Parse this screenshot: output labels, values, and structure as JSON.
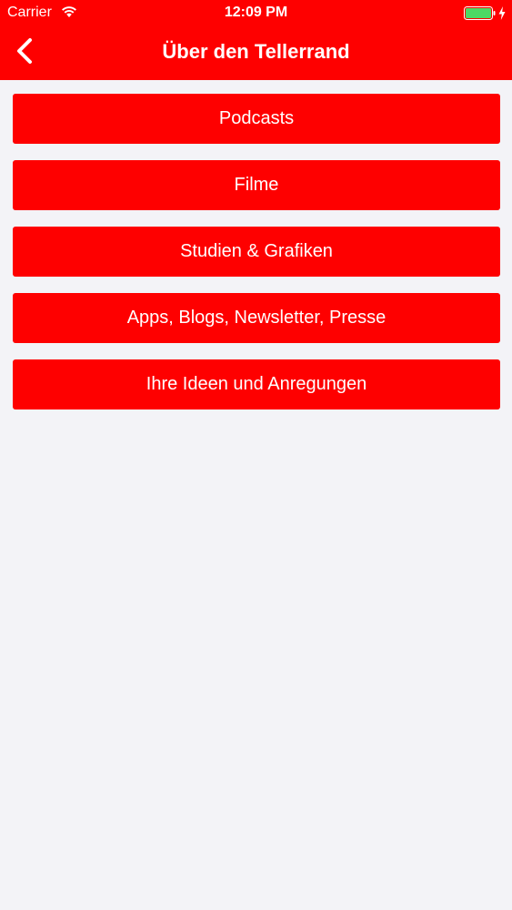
{
  "status_bar": {
    "carrier": "Carrier",
    "time": "12:09 PM",
    "wifi_icon": "wifi-icon",
    "battery_icon": "battery-full-icon",
    "charging_icon": "charging-bolt-icon"
  },
  "nav": {
    "title": "Über den Tellerrand",
    "back_icon": "chevron-left-icon"
  },
  "menu": {
    "items": [
      {
        "label": "Podcasts"
      },
      {
        "label": "Filme"
      },
      {
        "label": "Studien & Grafiken"
      },
      {
        "label": "Apps, Blogs, Newsletter, Presse"
      },
      {
        "label": "Ihre Ideen und Anregungen"
      }
    ]
  },
  "colors": {
    "accent": "#fe0000",
    "background": "#f3f3f7",
    "text_on_accent": "#ffffff",
    "battery_fill": "#4cd964"
  }
}
